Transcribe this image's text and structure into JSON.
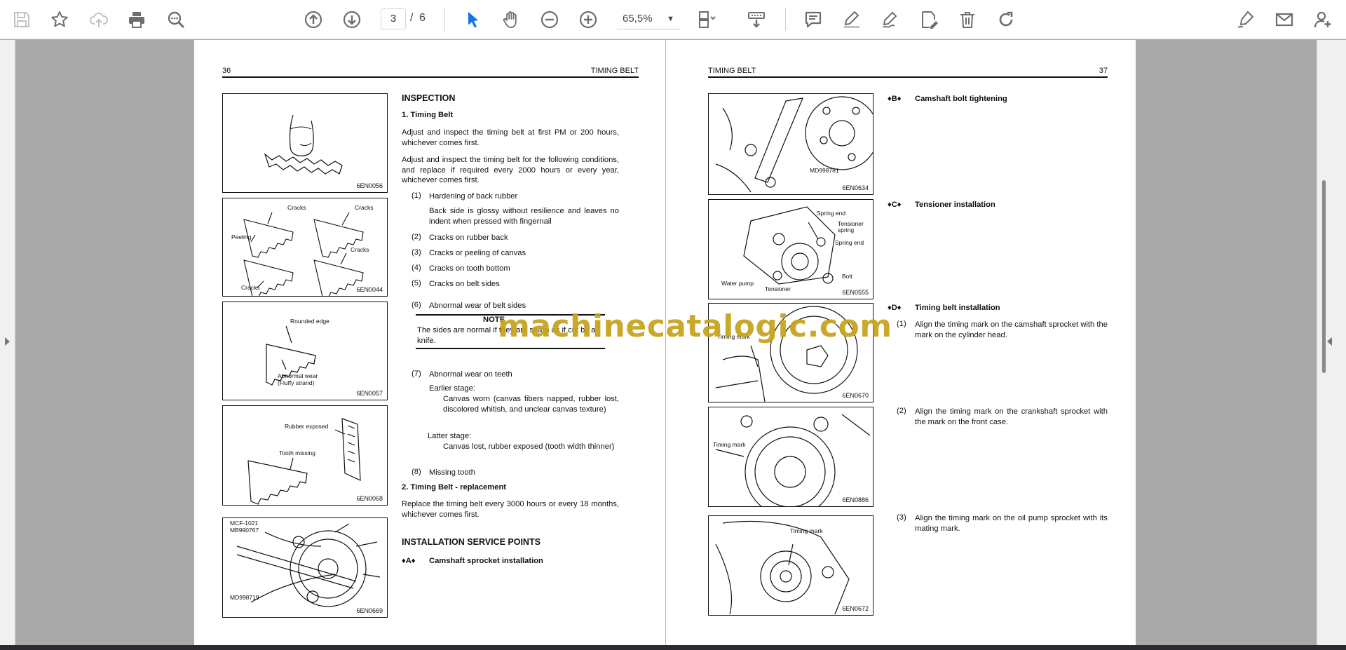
{
  "toolbar": {
    "page_current": "3",
    "page_separator": "/",
    "page_total": "6",
    "zoom": "65,5%"
  },
  "left_page": {
    "page_number": "36",
    "header_title": "TIMING BELT",
    "figure_codes": [
      "6EN0056",
      "6EN0044",
      "6EN0057",
      "6EN0068",
      "6EN0669"
    ],
    "fig2_labels": [
      "Cracks",
      "Cracks",
      "Peeling",
      "Cracks",
      "Cracks"
    ],
    "fig3_labels": [
      "Rounded edge",
      "Abnormal wear",
      "(Fluffy strand)"
    ],
    "fig4_labels": [
      "Rubber exposed",
      "Tooth missing"
    ],
    "fig5_labels": [
      "MCF-1021",
      "MB990767",
      "MD998719"
    ],
    "inspection_title": "INSPECTION",
    "s1_title": "1.   Timing Belt",
    "p1": "Adjust and inspect the timing belt at first PM or 200 hours, whichever comes first.",
    "p2": "Adjust and inspect the timing belt for the following conditions, and replace if required every 2000 hours or every year, whichever comes first.",
    "items": [
      {
        "num": "(1)",
        "text": "Hardening of back rubber"
      },
      {
        "num": "(2)",
        "text": "Cracks on rubber back"
      },
      {
        "num": "(3)",
        "text": "Cracks or peeling of canvas"
      },
      {
        "num": "(4)",
        "text": "Cracks on tooth bottom"
      },
      {
        "num": "(5)",
        "text": "Cracks on belt sides"
      },
      {
        "num": "(6)",
        "text": "Abnormal wear of belt sides"
      },
      {
        "num": "(7)",
        "text": "Abnormal wear on teeth"
      },
      {
        "num": "(8)",
        "text": "Missing tooth"
      }
    ],
    "item1_detail": "Back side is glossy without resilience and leaves no indent when pressed with fingernail",
    "note_title": "NOTE",
    "note_text": "The sides are normal if they are sharp as if cut by a knife.",
    "earlier_label": "Earlier stage:",
    "earlier_text": "Canvas worn (canvas fibers napped, rubber lost, discolored whitish, and unclear canvas texture)",
    "latter_label": "Latter stage:",
    "latter_text": "Canvas lost, rubber exposed (tooth width thinner)",
    "s2_title": "2.   Timing Belt - replacement",
    "p3": "Replace the timing belt every 3000 hours or every 18 months, whichever comes first.",
    "install_title": "INSTALLATION SERVICE POINTS",
    "a_marker": "♦A♦",
    "a_title": "Camshaft sprocket installation"
  },
  "right_page": {
    "page_number": "37",
    "header_title": "TIMING BELT",
    "figure_codes": [
      "6EN0634",
      "6EN0555",
      "6EN0670",
      "6EN0886",
      "6EN0672"
    ],
    "fig1_labels": [
      "MD998781"
    ],
    "fig2_labels": [
      "Spring end",
      "Tensioner spring",
      "Spring end",
      "Bolt",
      "Water pump",
      "Tensioner"
    ],
    "fig3_labels": [
      "Timing mark"
    ],
    "fig4_labels": [
      "Timing mark"
    ],
    "fig5_labels": [
      "Timing mark"
    ],
    "b_marker": "♦B♦",
    "b_title": "Camshaft bolt tightening",
    "c_marker": "♦C♦",
    "c_title": "Tensioner installation",
    "d_marker": "♦D♦",
    "d_title": "Timing belt installation",
    "steps": [
      {
        "num": "(1)",
        "text": "Align the timing mark on the camshaft sprocket with the mark on the cylinder head."
      },
      {
        "num": "(2)",
        "text": "Align the timing mark on the crankshaft sprocket with the mark on the front case."
      },
      {
        "num": "(3)",
        "text": "Align the timing mark on the oil pump sprocket with its mating mark."
      }
    ]
  },
  "watermark": "machinecatalogic.com",
  "colors": {
    "toolbar_icon": "#6e6e6e",
    "toolbar_accent": "#1473e6",
    "watermark": "#c8a41f",
    "viewer_bg": "#a9a9a9"
  },
  "icons": [
    "save-icon",
    "bookmark-star-icon",
    "cloud-upload-icon",
    "print-icon",
    "find-zoom-icon",
    "page-up-icon",
    "page-down-icon",
    "select-cursor-icon",
    "hand-pan-icon",
    "zoom-out-icon",
    "zoom-in-icon",
    "fit-page-icon",
    "scroll-mode-icon",
    "comment-icon",
    "highlight-pen-icon",
    "draw-pen-icon",
    "stamp-icon",
    "delete-icon",
    "rotate-icon",
    "fill-sign-icon",
    "mail-icon",
    "add-user-icon"
  ]
}
